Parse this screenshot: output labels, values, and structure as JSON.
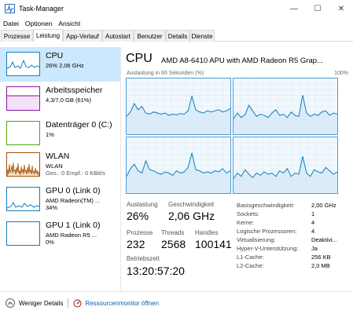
{
  "window": {
    "title": "Task-Manager",
    "minimize": "—",
    "maximize": "☐",
    "close": "✕"
  },
  "menu": [
    "Datei",
    "Optionen",
    "Ansicht"
  ],
  "tabs": [
    "Prozesse",
    "Leistung",
    "App-Verlauf",
    "Autostart",
    "Benutzer",
    "Details",
    "Dienste"
  ],
  "sidebar": {
    "items": [
      {
        "name": "CPU",
        "lines": [
          "26%  2,06 GHz"
        ],
        "color": "#117dbb"
      },
      {
        "name": "Arbeitsspeicher",
        "lines": [
          "4,3/7,0 GB (61%)"
        ],
        "color": "#8b12ae"
      },
      {
        "name": "Datenträger 0 (C:)",
        "lines": [
          "1%"
        ],
        "color": "#4da60c"
      },
      {
        "name": "WLAN",
        "lines": [
          "WLAN",
          "Ges.: 0  Empf.: 0 KBit/s"
        ],
        "color": "#a74f01"
      },
      {
        "name": "GPU 0 (Link 0)",
        "lines": [
          "AMD Radeon(TM) ...",
          "34%"
        ],
        "color": "#117dbb"
      },
      {
        "name": "GPU 1 (Link 0)",
        "lines": [
          "AMD Radeon R5 ...",
          "0%"
        ],
        "color": "#117dbb"
      }
    ]
  },
  "main": {
    "title": "CPU",
    "model": "AMD A8-6410 APU with AMD Radeon R5 Grap...",
    "graph_caption": "Auslastung in 60 Sekunden (%)",
    "graph_max": "100%",
    "stats": {
      "utilization_label": "Auslastung",
      "utilization": "26%",
      "speed_label": "Geschwindigkeit",
      "speed": "2,06 GHz",
      "processes_label": "Prozesse",
      "processes": "232",
      "threads_label": "Threads",
      "threads": "2568",
      "handles_label": "Handles",
      "handles": "100141",
      "uptime_label": "Betriebszeit",
      "uptime": "13:20:57:20"
    },
    "info": [
      {
        "label": "Basisgeschwindigkeit:",
        "value": "2,00 GHz"
      },
      {
        "label": "Sockets:",
        "value": "1"
      },
      {
        "label": "Kerne:",
        "value": "4"
      },
      {
        "label": "Logische Prozessoren:",
        "value": "4"
      },
      {
        "label": "Virtualisierung:",
        "value": "Deaktivi..."
      },
      {
        "label": "Hyper-V-Unterstützung:",
        "value": "Ja"
      },
      {
        "label": "L1-Cache:",
        "value": "256 KB"
      },
      {
        "label": "L2-Cache:",
        "value": "2,0 MB"
      }
    ]
  },
  "footer": {
    "fewer_details": "Weniger Details",
    "resource_monitor": "Ressourcenmonitor öffnen"
  },
  "chart_data": {
    "type": "area",
    "unit": "%",
    "ylim": [
      0,
      100
    ],
    "series": [
      {
        "values": [
          32,
          40,
          55,
          44,
          50,
          38,
          36,
          40,
          38,
          36,
          38,
          34,
          36,
          35,
          37,
          36,
          42,
          68,
          44,
          40,
          38,
          42,
          40,
          42,
          44,
          40,
          42,
          46
        ]
      },
      {
        "values": [
          28,
          38,
          30,
          35,
          52,
          42,
          32,
          36,
          34,
          30,
          38,
          44,
          34,
          36,
          30,
          40,
          34,
          32,
          70,
          38,
          32,
          36,
          34,
          40,
          42,
          34,
          38,
          36
        ]
      },
      {
        "values": [
          30,
          44,
          52,
          40,
          36,
          58,
          42,
          40,
          36,
          34,
          38,
          36,
          32,
          40,
          36,
          38,
          46,
          72,
          42,
          40,
          36,
          38,
          36,
          40,
          38,
          44,
          36,
          40
        ]
      },
      {
        "values": [
          26,
          36,
          30,
          42,
          34,
          28,
          36,
          32,
          38,
          34,
          36,
          30,
          40,
          36,
          44,
          30,
          36,
          34,
          66,
          36,
          30,
          42,
          38,
          36,
          46,
          40,
          34,
          38
        ]
      }
    ]
  }
}
